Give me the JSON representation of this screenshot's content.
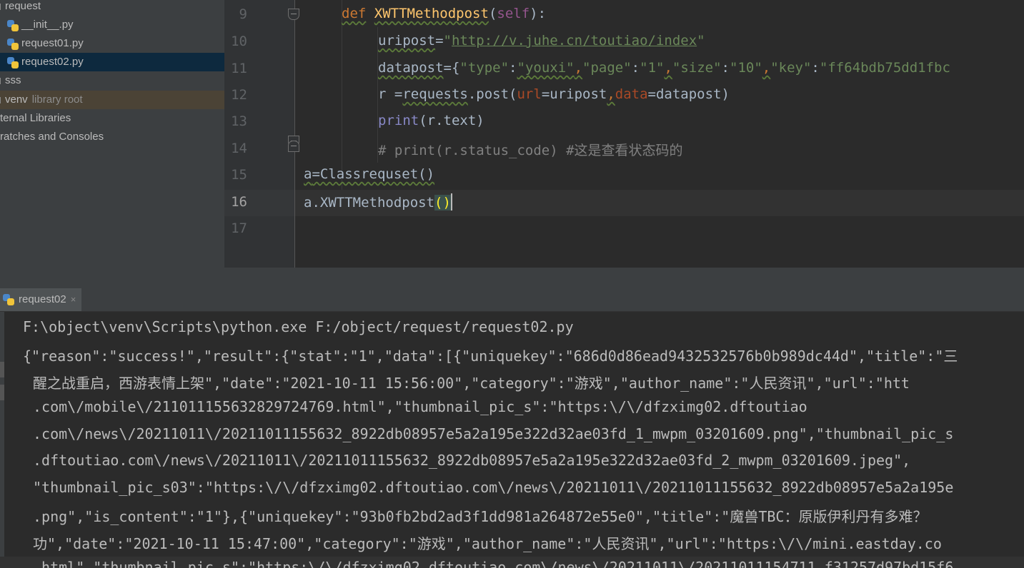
{
  "project_tree": {
    "items": [
      {
        "label": "request"
      },
      {
        "label": "__init__.py"
      },
      {
        "label": "request01.py"
      },
      {
        "label": "request02.py"
      },
      {
        "label": "sss"
      },
      {
        "label": "venv",
        "suffix": "library root"
      },
      {
        "label": "ternal Libraries"
      },
      {
        "label": "ratches and Consoles"
      }
    ]
  },
  "editor": {
    "line_numbers": [
      "9",
      "10",
      "11",
      "12",
      "13",
      "14",
      "15",
      "16",
      "17"
    ],
    "current_line": "16",
    "lines": {
      "l9": {
        "def": "def",
        "name": "XWTTMethodpost",
        "open": "(",
        "self": "self",
        "close": "):"
      },
      "l10": {
        "var": "uripost",
        "eq": "=",
        "q1": "\"",
        "url": "http://v.juhe.cn/toutiao/index",
        "q2": "\""
      },
      "l11": {
        "var": "datapost",
        "open": "={",
        "k1": "\"type\"",
        "c1": ":",
        "v1": "\"youxi\"",
        "s1": ",",
        "k2": "\"page\"",
        "c2": ":",
        "v2": "\"1\"",
        "s2": ",",
        "k3": "\"size\"",
        "c3": ":",
        "v3": "\"10\"",
        "s3": ",",
        "k4": "\"key\"",
        "c4": ":",
        "v4": "\"ff64bdb75dd1fbc"
      },
      "l12": {
        "a": "r =",
        "b": "requests",
        "c": ".post(",
        "p1": "url",
        "d": "=uripost",
        "e": ",",
        "p2": "data",
        "f": "=datapost)"
      },
      "l13": {
        "fn": "print",
        "rest": "(r.text)"
      },
      "l14": {
        "comment": "# print(r.status_code) #这是查看状态码的"
      },
      "l15": {
        "a": "a",
        "b": "=Classrequset()"
      },
      "l16": {
        "a": "a.XWTTMethodpost",
        "b": "()"
      }
    }
  },
  "run_panel": {
    "tab_label": "request02",
    "close": "×",
    "output": [
      "F:\\object\\venv\\Scripts\\python.exe F:/object/request/request02.py",
      "{\"reason\":\"success!\",\"result\":{\"stat\":\"1\",\"data\":[{\"uniquekey\":\"686d0d86ead9432532576b0b989dc44d\",\"title\":\"三",
      "醒之战重启，西游表情上架\",\"date\":\"2021-10-11 15:56:00\",\"category\":\"游戏\",\"author_name\":\"人民资讯\",\"url\":\"htt",
      ".com\\/mobile\\/211011155632829724769.html\",\"thumbnail_pic_s\":\"https:\\/\\/dfzximg02.dftoutiao",
      ".com\\/news\\/20211011\\/20211011155632_8922db08957e5a2a195e322d32ae03fd_1_mwpm_03201609.png\",\"thumbnail_pic_s",
      ".dftoutiao.com\\/news\\/20211011\\/20211011155632_8922db08957e5a2a195e322d32ae03fd_2_mwpm_03201609.jpeg\",",
      "\"thumbnail_pic_s03\":\"https:\\/\\/dfzximg02.dftoutiao.com\\/news\\/20211011\\/20211011155632_8922db08957e5a2a195e",
      ".png\",\"is_content\":\"1\"},{\"uniquekey\":\"93b0fb2bd2ad3f1dd981a264872e55e0\",\"title\":\"魔兽TBC：原版伊利丹有多难？",
      "功\",\"date\":\"2021-10-11 15:47:00\",\"category\":\"游戏\",\"author_name\":\"人民资讯\",\"url\":\"https:\\/\\/mini.eastday.co",
      ".html\",\"thumbnail_pic_s\":\"https:\\/\\/dfzximg02.dftoutiao.com\\/news\\/20211011\\/20211011154711_f31257d97bd15f6"
    ]
  },
  "colors": {
    "editor_bg": "#2b2b2b",
    "panel_bg": "#3c3f41",
    "keyword": "#cc7832",
    "function": "#ffc66d",
    "string": "#6a8759",
    "comment": "#808080",
    "selection": "#0d293e"
  }
}
